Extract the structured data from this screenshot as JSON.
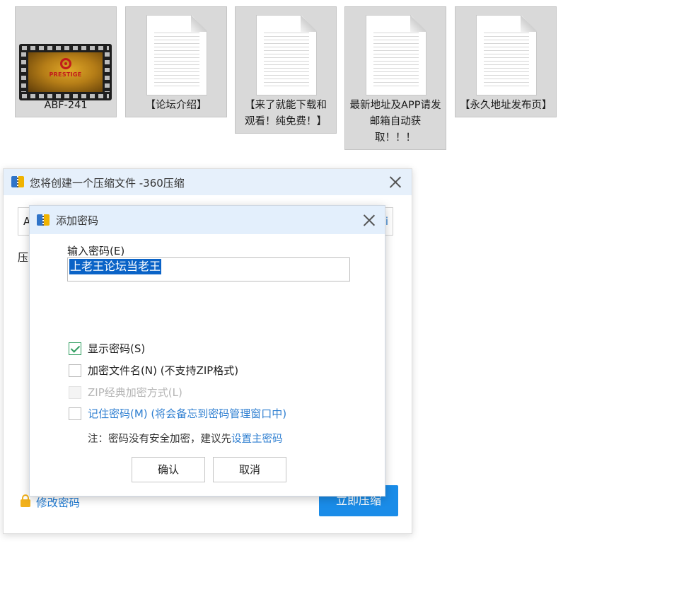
{
  "files": [
    {
      "name": "ABF-241",
      "type": "video",
      "thumb_text": "PRESTIGE"
    },
    {
      "name": "【论坛介绍】",
      "type": "doc"
    },
    {
      "name": "【来了就能下载和观看！纯免费！】",
      "type": "doc"
    },
    {
      "name": "最新地址及APP请发邮箱自动获取！！！",
      "type": "doc"
    },
    {
      "name": "【永久地址发布页】",
      "type": "doc"
    }
  ],
  "outer_dialog": {
    "title": "您将创建一个压缩文件 -360压缩",
    "field_prefix": "A",
    "field_tail": "i",
    "label_prefix": "压",
    "change_password_label": "修改密码",
    "compress_button": "立即压缩"
  },
  "inner_dialog": {
    "title": "添加密码",
    "password_label": "输入密码(E)",
    "password_value": "上老王论坛当老王",
    "show_password": {
      "label": "显示密码(S)",
      "checked": true
    },
    "encrypt_filename": {
      "label": "加密文件名(N) (不支持ZIP格式)",
      "checked": false
    },
    "zip_classic": {
      "label": "ZIP经典加密方式(L)",
      "checked": false,
      "disabled": true
    },
    "remember_password": {
      "label": "记住密码(M) (将会备忘到密码管理窗口中)",
      "checked": false
    },
    "note_prefix": "注：密码没有安全加密，建议先",
    "note_link": "设置主密码",
    "ok_button": "确认",
    "cancel_button": "取消"
  },
  "colors": {
    "accent": "#1a8ce8",
    "link": "#2f7fd1",
    "selection": "#0a63c7",
    "titlebar": "#e3effc",
    "tile_bg": "#d9d9d9"
  }
}
